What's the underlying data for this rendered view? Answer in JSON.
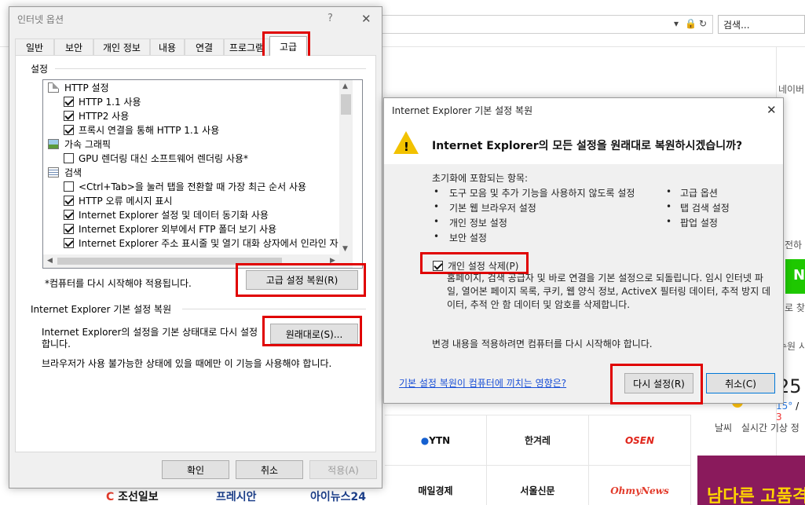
{
  "browser": {
    "search_placeholder": "검색...",
    "right_texts": [
      "네이버",
      "전하",
      "로 찾",
      "수원 시",
      "25",
      "날씨",
      "실시간 기상 정"
    ],
    "temps": {
      "low": "15°",
      "high": "3"
    },
    "green_letter": "N",
    "banner_text": "남다른 고품격",
    "news_logos": [
      "YTN",
      "한겨레",
      "OSEN",
      "매일경제",
      "서울신문",
      "OhmyNews"
    ],
    "bottom_logos": [
      "조선일보",
      "프레시안",
      "아이뉴스24"
    ]
  },
  "internet_options": {
    "title": "인터넷 옵션",
    "tabs": [
      "일반",
      "보안",
      "개인 정보",
      "내용",
      "연결",
      "프로그램",
      "고급"
    ],
    "active_tab": "고급",
    "settings_label": "설정",
    "tree": [
      {
        "kind": "group",
        "icon": "doc",
        "label": "HTTP 설정"
      },
      {
        "kind": "check",
        "checked": true,
        "label": "HTTP 1.1 사용"
      },
      {
        "kind": "check",
        "checked": true,
        "label": "HTTP2 사용"
      },
      {
        "kind": "check",
        "checked": true,
        "label": "프록시 연결을 통해 HTTP 1.1 사용"
      },
      {
        "kind": "group",
        "icon": "pic",
        "label": "가속 그래픽"
      },
      {
        "kind": "check",
        "checked": false,
        "label": "GPU 렌더링 대신 소프트웨어 렌더링 사용*"
      },
      {
        "kind": "group",
        "icon": "list",
        "label": "검색"
      },
      {
        "kind": "check",
        "checked": false,
        "label": "<Ctrl+Tab>을 눌러 탭을 전환할 때 가장 최근 순서 사용"
      },
      {
        "kind": "check",
        "checked": true,
        "label": "HTTP 오류 메시지 표시"
      },
      {
        "kind": "check",
        "checked": true,
        "label": "Internet Explorer 설정 및 데이터 동기화 사용"
      },
      {
        "kind": "check",
        "checked": true,
        "label": "Internet Explorer 외부에서 FTP 폴더 보기 사용"
      },
      {
        "kind": "check",
        "checked": true,
        "label": "Internet Explorer 주소 표시줄 및 열기 대화 상자에서 인라인 자"
      }
    ],
    "restart_note": "*컴퓨터를 다시 시작해야 적용됩니다.",
    "restore_advanced_btn": "고급 설정 복원(R)",
    "reset_group_label": "Internet Explorer 기본 설정 복원",
    "reset_desc_line1": "Internet Explorer의 설정을 기본 상태대로 다시 설정",
    "reset_desc_line2": "합니다.",
    "reset_btn": "원래대로(S)...",
    "broken_note": "브라우저가 사용 불가능한 상태에 있을 때에만 이 기능을 사용해야 합니다.",
    "ok": "확인",
    "cancel": "취소",
    "apply": "적용(A)"
  },
  "reset_dialog": {
    "title": "Internet Explorer 기본 설정 복원",
    "question": "Internet Explorer의 모든 설정을 원래대로 복원하시겠습니까?",
    "includes_label": "초기화에 포함되는 항목:",
    "items_left": [
      "도구 모음 및 추가 기능을 사용하지 않도록 설정",
      "기본 웹 브라우저 설정",
      "개인 정보 설정",
      "보안 설정"
    ],
    "items_right": [
      "고급 옵션",
      "탭 검색 설정",
      "팝업 설정"
    ],
    "delete_personal_label": "개인 설정 삭제(P)",
    "delete_personal_checked": true,
    "delete_desc": "홈페이지, 검색 공급자 및 바로 연결을 기본 설정으로 되돌립니다. 임시 인터넷 파일, 열어본 페이지 목록, 쿠키, 웹 양식 정보, ActiveX 필터링 데이터, 추적 방지 데이터, 추적 안 함 데이터 및 암호를 삭제합니다.",
    "restart_note": "변경 내용을 적용하려면 컴퓨터를 다시 시작해야 합니다.",
    "help_link": "기본 설정 복원이 컴퓨터에 끼치는 영향은?",
    "reset_btn": "다시 설정(R)",
    "cancel_btn": "취소(C)"
  },
  "colors": {
    "highlight": "#e00000",
    "link": "#1a4fd6",
    "warning": "#f2c200",
    "naver_green": "#1ec800"
  }
}
